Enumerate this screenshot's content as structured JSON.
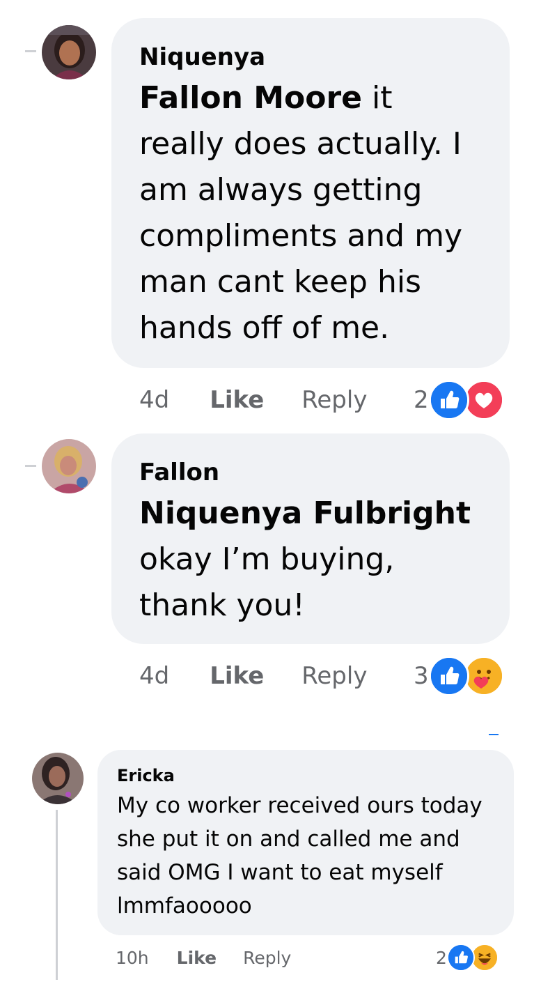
{
  "comments": [
    {
      "author": "Niquenya",
      "mention": "Fallon Moore",
      "text": " it really does actually. I am always getting compliments and my man cant keep his hands off of me.",
      "time": "4d",
      "like_label": "Like",
      "reply_label": "Reply",
      "reaction_count": "2",
      "reactions": [
        "like-icon",
        "love-icon"
      ]
    },
    {
      "author": "Fallon",
      "mention": "Niquenya Fulbright",
      "text": "okay I’m buying, thank you!",
      "time": "4d",
      "like_label": "Like",
      "reply_label": "Reply",
      "reaction_count": "3",
      "reactions": [
        "like-icon",
        "care-icon"
      ]
    },
    {
      "author": "Ericka",
      "text": "My co worker received ours today she put it on and called me and said OMG I want to eat myself lmmfaooooo",
      "time": "10h",
      "like_label": "Like",
      "reply_label": "Reply",
      "reaction_count": "2",
      "reactions": [
        "like-icon",
        "haha-icon"
      ]
    }
  ],
  "colors": {
    "bubble_bg": "#f0f2f5",
    "meta_text": "#65676b",
    "like_blue": "#1877f2",
    "love_red": "#f33e58",
    "care_yellow": "#f7b125"
  }
}
